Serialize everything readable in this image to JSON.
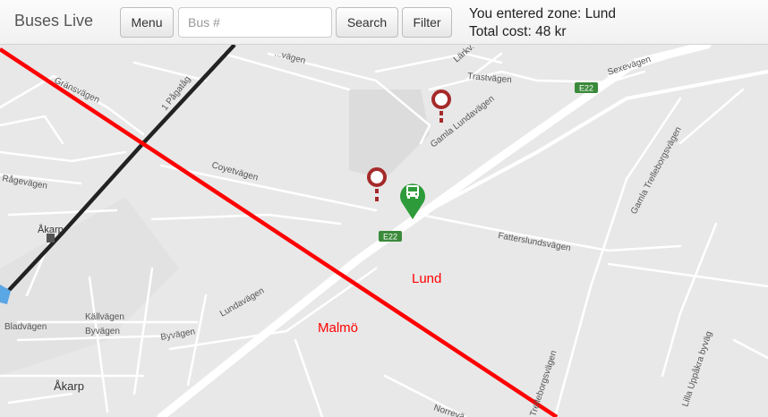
{
  "app": {
    "title": "Buses Live"
  },
  "toolbar": {
    "menu_label": "Menu",
    "bus_placeholder": "Bus #",
    "bus_value": "",
    "search_label": "Search",
    "filter_label": "Filter"
  },
  "status": {
    "zone_text": "You entered zone: Lund",
    "cost_text": "Total cost: 48 kr"
  },
  "map": {
    "zone_labels": {
      "lund": "Lund",
      "malmo": "Malmö"
    },
    "places": {
      "akarp_town": "Åkarp",
      "akarp_station": "Åkarp"
    },
    "route_badges": {
      "e22_top": "E22",
      "e22_mid": "E22"
    },
    "roads": {
      "gransvagen": "Gränsvägen",
      "pagatag": "1 Pågatåg",
      "coyetvagen": "Coyetvägen",
      "gamla_lundavagen": "Gamla Lundavägen",
      "trastvagen": "Trastvägen",
      "larkvagen": "Lärkv.",
      "sexevagen": "Sexevägen",
      "fatterslundsvagen": "Fatterslundsvägen",
      "lundavagen": "Lundavägen",
      "gamla_trelleborgsvagen": "Gamla Trelleborgsvägen",
      "trelleborgsvagen": "Trelleborgsvägen",
      "lilla_uppakra": "Lilla Uppåkra byväg",
      "kallvagen": "Källvägen",
      "byvagen_1": "Byvägen",
      "byvagen_2": "Byvägen",
      "bladvagen": "Bladvägen",
      "ragevagen": "Rågevägen",
      "norrevagen": "Norrevä",
      "dagvagen": "...vägen"
    },
    "colors": {
      "zone_border": "#ff0000",
      "railway": "#222222",
      "stop_marker": "#a52a2a",
      "bus_marker": "#2e9b3a",
      "badge": "#3a8a3a"
    }
  }
}
